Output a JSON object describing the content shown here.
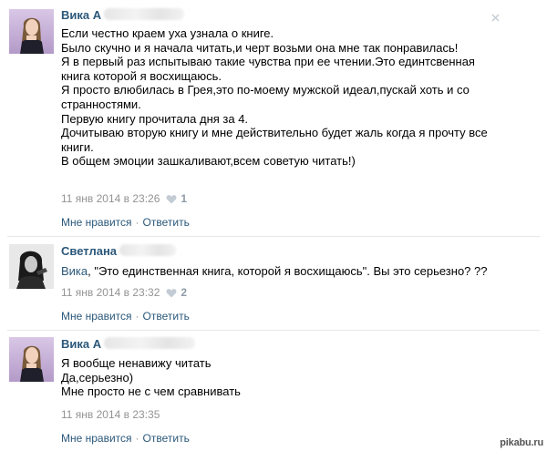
{
  "comments": [
    {
      "author": "Вика А",
      "lines": [
        "Если честно краем уха узнала о книге.",
        "Было скучно и я начала читать,и черт возьми она мне так понравилась!",
        "Я в первый раз испытываю такие чувства при ее чтении.Это единтсвенная",
        "книга которой я восхищаюсь.",
        "Я просто влюбилась в Грея,это по-моему мужской идеал,пускай хоть и со",
        "странностями.",
        "Первую книгу прочитала дня за 4.",
        "Дочитываю вторую книгу и мне действительно будет жаль когда я прочту все",
        "книги.",
        "В общем эмоции зашкаливают,всем советую читать!)"
      ],
      "timestamp": "11 янв 2014 в 23:26",
      "likes": "1",
      "like_label": "Мне нравится",
      "reply_label": "Ответить",
      "separator": "·"
    },
    {
      "author": "Светлана",
      "mention": "Вика",
      "text": ", \"Это единственная книга, которой я восхищаюсь\". Вы это серьезно? ??",
      "timestamp": "11 янв 2014 в 23:32",
      "likes": "2",
      "like_label": "Мне нравится",
      "reply_label": "Ответить",
      "separator": "·"
    },
    {
      "author": "Вика А",
      "lines": [
        "Я вообще ненавижу читать",
        "Да,серьезно)",
        "Мне просто не с чем сравнивать"
      ],
      "timestamp": "11 янв 2014 в 23:35",
      "like_label": "Мне нравится",
      "reply_label": "Ответить",
      "separator": "·"
    }
  ],
  "watermark": "pikabu.ru",
  "colors": {
    "link": "#2b587a",
    "meta": "#939393",
    "divider": "#e7e8ec"
  }
}
